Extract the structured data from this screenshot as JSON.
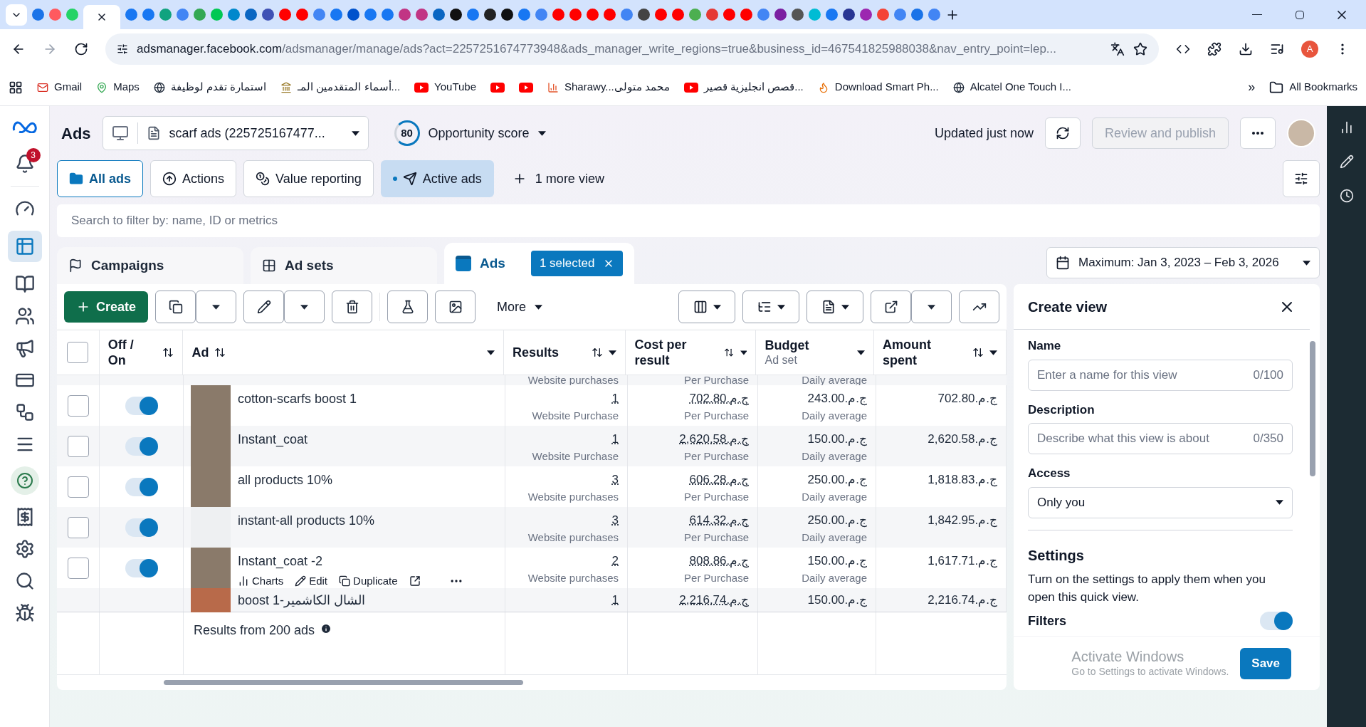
{
  "browser": {
    "url_host": "adsmanager.facebook.com",
    "url_path": "/adsmanager/manage/ads?act=2257251674773948&ads_manager_write_regions=true&business_id=467541825988038&nav_entry_point=lep...",
    "profile": "A",
    "bookmarks": [
      {
        "label": "Gmail",
        "kind": "mail"
      },
      {
        "label": "Maps",
        "kind": "pin"
      },
      {
        "label": "استمارة تقدم لوظيفة",
        "kind": "globe"
      },
      {
        "label": "أسماء المتقدمين المـ...",
        "kind": "emblem"
      },
      {
        "label": "YouTube",
        "kind": "play"
      },
      {
        "kind": "play"
      },
      {
        "kind": "play"
      },
      {
        "label": "Sharawy...محمد متولى",
        "kind": "bars"
      },
      {
        "label": "قصص انجليزية قصير...",
        "kind": "play"
      },
      {
        "label": "Download Smart Ph...",
        "kind": "flame"
      },
      {
        "label": "Alcatel One Touch I...",
        "kind": "globe"
      }
    ],
    "overflow": "»",
    "all_bookmarks": "All Bookmarks"
  },
  "header": {
    "title": "Ads",
    "account": "scarf ads (225725167477...",
    "score": "80",
    "score_label": "Opportunity score",
    "updated": "Updated just now",
    "publish": "Review and publish",
    "publish_disabled": true
  },
  "notifications": "3",
  "view_tabs": [
    {
      "label": "All ads",
      "kind": "folder",
      "selected": true
    },
    {
      "label": "Actions",
      "kind": "upload",
      "selected": false
    },
    {
      "label": "Value reporting",
      "kind": "coins",
      "selected": false
    },
    {
      "label": "Active ads",
      "kind": "send",
      "selected": false,
      "highlighted": true
    }
  ],
  "more_views": "1 more view",
  "search": {
    "placeholder": "Search to filter by: name, ID or metrics"
  },
  "level_tabs": [
    {
      "label": "Campaigns",
      "kind": "flag",
      "selected": false
    },
    {
      "label": "Ad sets",
      "kind": "grid",
      "selected": false
    },
    {
      "label": "Ads",
      "kind": "ad",
      "selected": true
    }
  ],
  "selection": "1 selected",
  "date_range": "Maximum: Jan 3, 2023 – Feb 3, 2026",
  "toolbar": {
    "create": "Create",
    "more": "More"
  },
  "select_all_checked": false,
  "columns": [
    {
      "label": "Off / On",
      "sortable": true
    },
    {
      "label": "Ad",
      "sortable": true
    },
    {
      "label": "Results",
      "sortable": true
    },
    {
      "label": "Cost per result",
      "sortable": true
    },
    {
      "label": "Budget",
      "sub": "Ad set",
      "sortable": false
    },
    {
      "label": "Amount spent",
      "sortable": true
    }
  ],
  "top_partial": {
    "results_label": "Website purchases",
    "cost_label": "Per Purchase",
    "budget_label": "Daily average"
  },
  "rows": [
    {
      "name": "cotton-scarfs boost 1",
      "checked": false,
      "on": true,
      "thumb": true,
      "results": "1",
      "results_label": "Website Purchase",
      "cost": "ج.م.702.80",
      "cost_label": "Per Purchase",
      "budget": "ج.م.243.00",
      "budget_label": "Daily average",
      "amount": "ج.م.702.80"
    },
    {
      "name": "Instant_coat",
      "checked": false,
      "on": true,
      "thumb": true,
      "results": "1",
      "results_label": "Website Purchase",
      "cost": "ج.م.2,620.58",
      "cost_label": "Per Purchase",
      "budget": "ج.م.150.00",
      "budget_label": "Daily average",
      "amount": "ج.م.2,620.58"
    },
    {
      "name": "all products 10%",
      "checked": false,
      "on": true,
      "thumb": true,
      "results": "3",
      "results_label": "Website purchases",
      "cost": "ج.م.606.28",
      "cost_label": "Per Purchase",
      "budget": "ج.م.250.00",
      "budget_label": "Daily average",
      "amount": "ج.م.1,818.83"
    },
    {
      "name": "instant-all products 10%",
      "checked": false,
      "on": true,
      "thumb": false,
      "results": "3",
      "results_label": "Website purchases",
      "cost": "ج.م.614.32",
      "cost_label": "Per Purchase",
      "budget": "ج.م.250.00",
      "budget_label": "Daily average",
      "amount": "ج.م.1,842.95"
    },
    {
      "name": "Instant_coat -2",
      "checked": false,
      "on": true,
      "thumb": true,
      "results": "2",
      "results_label": "Website purchases",
      "cost": "ج.م.808.86",
      "cost_label": "Per Purchase",
      "budget": "ج.م.150.00",
      "budget_label": "Daily average",
      "amount": "ج.م.1,617.71",
      "actions": [
        "Charts",
        "Edit",
        "Duplicate"
      ]
    }
  ],
  "bottom_partial": {
    "name": "boost 1-الشال الكاشمير",
    "results": "1",
    "cost": "ج.م.2,216.74",
    "budget": "ج.م.150.00",
    "amount": "ج.م.2,216.74"
  },
  "footer": "Results from 200 ads",
  "create_view": {
    "title": "Create view",
    "name_label": "Name",
    "name_placeholder": "Enter a name for this view",
    "name_count": "0/100",
    "desc_label": "Description",
    "desc_placeholder": "Describe what this view is about",
    "desc_count": "0/350",
    "access_label": "Access",
    "access_value": "Only you",
    "settings_title": "Settings",
    "settings_text": "Turn on the settings to apply them when you open this quick view.",
    "filters_label": "Filters",
    "filters_on": true,
    "save": "Save"
  },
  "os_notice": {
    "title": "Activate Windows",
    "text": "Go to Settings to activate Windows."
  }
}
